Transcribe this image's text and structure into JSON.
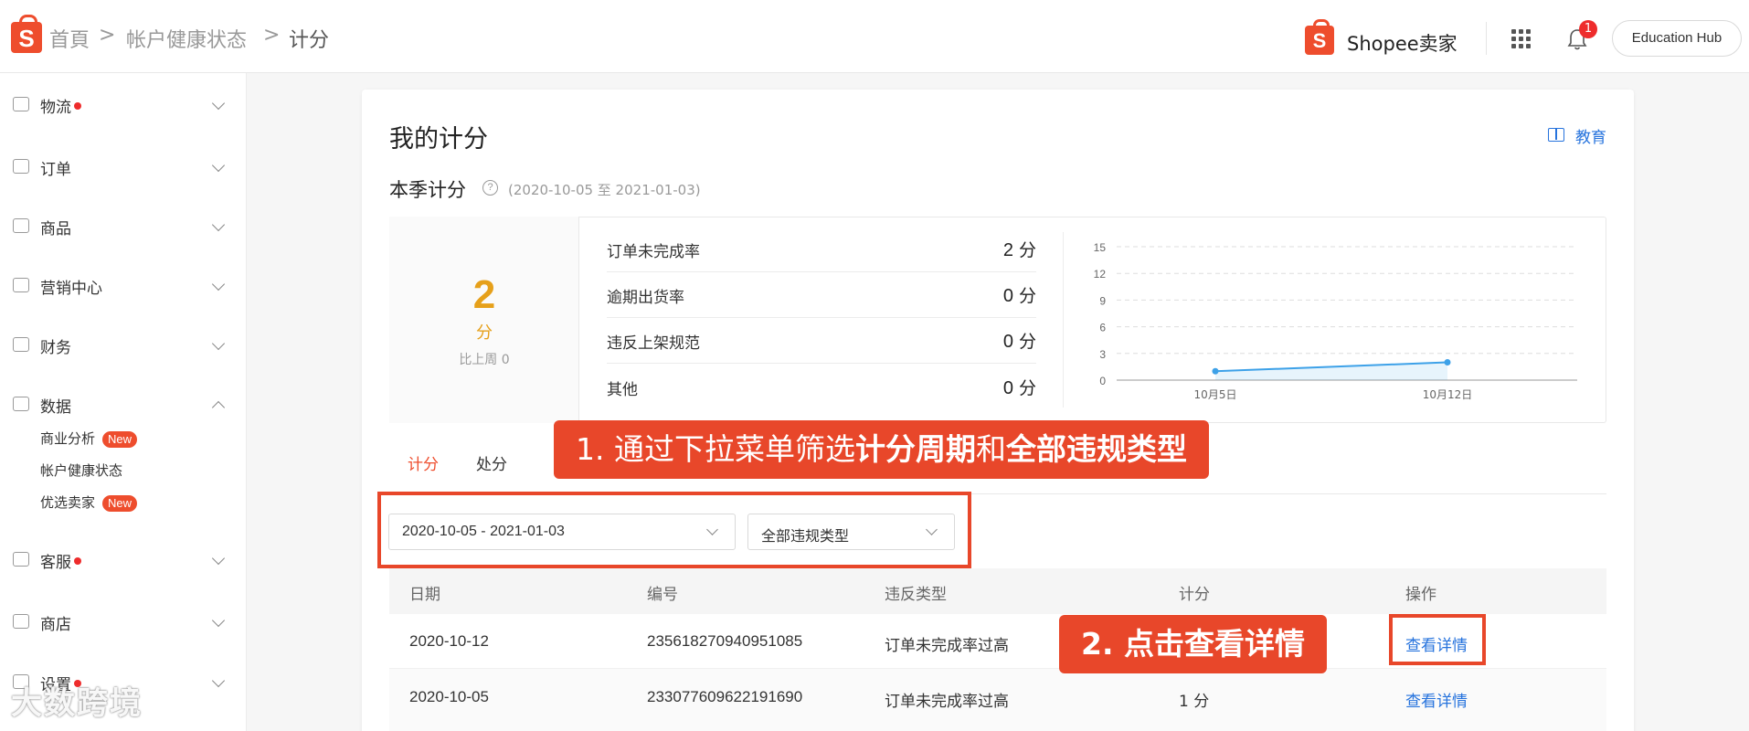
{
  "header": {
    "breadcrumb": [
      "首頁",
      "帐户健康状态",
      "计分"
    ],
    "separator": ">",
    "brand": "Shopee卖家",
    "notification_count": "1",
    "edu_hub": "Education Hub"
  },
  "sidebar": {
    "items": [
      {
        "label": "物流",
        "dot": true
      },
      {
        "label": "订单",
        "dot": false
      },
      {
        "label": "商品",
        "dot": false
      },
      {
        "label": "营销中心",
        "dot": false
      },
      {
        "label": "财务",
        "dot": false
      },
      {
        "label": "数据",
        "dot": false,
        "expanded": true
      },
      {
        "label": "客服",
        "dot": true
      },
      {
        "label": "商店",
        "dot": false
      },
      {
        "label": "设置",
        "dot": true
      }
    ],
    "sub_items": [
      {
        "label": "商业分析",
        "badge": "New"
      },
      {
        "label": "帐户健康状态",
        "badge": ""
      },
      {
        "label": "优选卖家",
        "badge": "New"
      }
    ]
  },
  "main": {
    "title": "我的计分",
    "edu_link": "教育",
    "season_title": "本季计分",
    "season_range": "(2020-10-05 至 2021-01-03)",
    "score": {
      "value": "2",
      "unit": "分",
      "compare": "比上周 0"
    },
    "metrics": [
      {
        "name": "订单未完成率",
        "value": "2",
        "unit": "分"
      },
      {
        "name": "逾期出货率",
        "value": "0",
        "unit": "分"
      },
      {
        "name": "违反上架规范",
        "value": "0",
        "unit": "分"
      },
      {
        "name": "其他",
        "value": "0",
        "unit": "分"
      }
    ],
    "tabs": [
      "计分",
      "处分"
    ],
    "filters": {
      "date_range": "2020-10-05 - 2021-01-03",
      "violation_type": "全部违规类型"
    },
    "table": {
      "columns": [
        "日期",
        "编号",
        "违反类型",
        "计分",
        "操作"
      ],
      "rows": [
        {
          "date": "2020-10-12",
          "id": "235618270940951085",
          "type": "订单未完成率过高",
          "score": "",
          "action": "查看详情"
        },
        {
          "date": "2020-10-05",
          "id": "233077609622191690",
          "type": "订单未完成率过高",
          "score": "1 分",
          "action": "查看详情"
        }
      ]
    }
  },
  "annotations": {
    "step1_prefix": "1. 通过下拉菜单筛选",
    "step1_b1": "计分周期",
    "step1_mid": "和",
    "step1_b2": "全部违规类型",
    "step2_prefix": "2. 点击",
    "step2_bold": "查看详情"
  },
  "chart_data": {
    "type": "line",
    "x": [
      "10月5日",
      "10月12日"
    ],
    "series": [
      {
        "values": [
          1,
          2
        ]
      }
    ],
    "yticks": [
      0,
      3,
      6,
      9,
      12,
      15
    ],
    "ylim": [
      0,
      15
    ],
    "grid": true,
    "color": "#3da1e8"
  },
  "watermark": "大数跨境",
  "colors": {
    "accent": "#ee4d2d",
    "link": "#2673dd",
    "score": "#e6a01a",
    "annotation": "#e8472a"
  }
}
